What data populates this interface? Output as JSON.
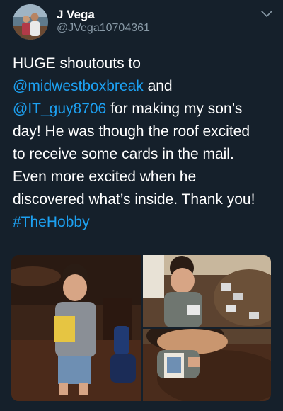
{
  "author": {
    "display_name": "J Vega",
    "handle": "@JVega10704361",
    "avatar_icon": "profile-photo-icon"
  },
  "tweet": {
    "lines": [
      [
        {
          "text": "HUGE shoutouts to",
          "type": "text"
        }
      ],
      [
        {
          "text": "@midwestboxbreak",
          "type": "mention"
        },
        {
          "text": " and",
          "type": "text"
        }
      ],
      [
        {
          "text": "@IT_guy8706",
          "type": "mention"
        },
        {
          "text": " for making my son’s",
          "type": "text"
        }
      ],
      [
        {
          "text": "day! He was though the roof excited",
          "type": "text"
        }
      ],
      [
        {
          "text": "to receive some cards in the mail.",
          "type": "text"
        }
      ],
      [
        {
          "text": "Even more excited when he",
          "type": "text"
        }
      ],
      [
        {
          "text": "discovered what’s inside. Thank you!",
          "type": "text"
        }
      ],
      [
        {
          "text": "#TheHobby",
          "type": "hashtag"
        }
      ]
    ]
  },
  "media": {
    "photos": [
      {
        "name": "photo-boy-holding-card-pack",
        "icon": "photo-icon"
      },
      {
        "name": "photo-boy-with-cards-at-table",
        "icon": "photo-icon"
      },
      {
        "name": "photo-boy-showing-card",
        "icon": "photo-icon"
      }
    ]
  },
  "colors": {
    "background": "#15202b",
    "text": "#ffffff",
    "secondary_text": "#8899a6",
    "link": "#1da1f2"
  }
}
